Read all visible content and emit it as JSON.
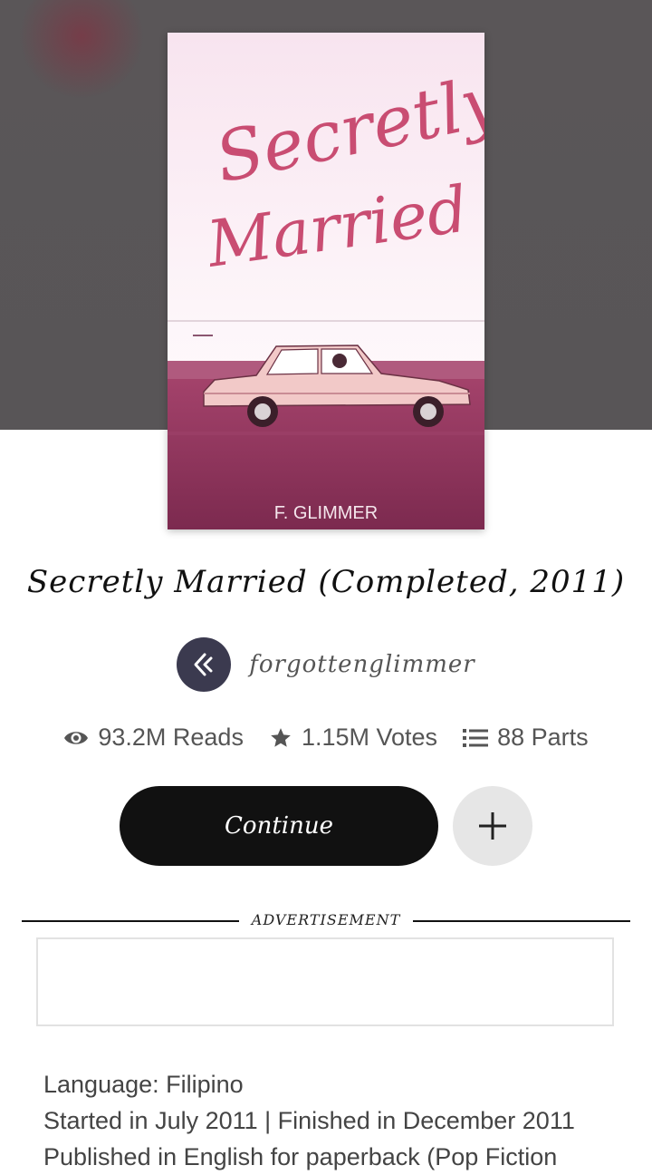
{
  "cover": {
    "title_line1": "Secretly",
    "title_line2": "Married",
    "author": "F. GLIMMER",
    "colors": {
      "title": "#c94d72",
      "road": "#8b2f55",
      "sky_top": "#f6e3ee",
      "sky_bottom": "#ffffff"
    }
  },
  "story": {
    "title": "Secretly Married (Completed, 2011)",
    "author_username": "forgottenglimmer"
  },
  "stats": {
    "reads": "93.2M Reads",
    "votes": "1.15M Votes",
    "parts": "88 Parts",
    "icons": [
      "eye-icon",
      "star-icon",
      "list-icon"
    ]
  },
  "actions": {
    "continue_label": "Continue",
    "add_icon": "plus-icon"
  },
  "ad": {
    "label": "ADVERTISEMENT"
  },
  "details": {
    "language": "Language: Filipino",
    "dates": "Started in July 2011 | Finished in December 2011",
    "published": "Published in English for paperback (Pop Fiction"
  },
  "colors": {
    "hero_bg": "#5a5658",
    "button_dark": "#111111",
    "button_light": "#e6e6e6",
    "avatar_bg": "#3b3a4f"
  }
}
